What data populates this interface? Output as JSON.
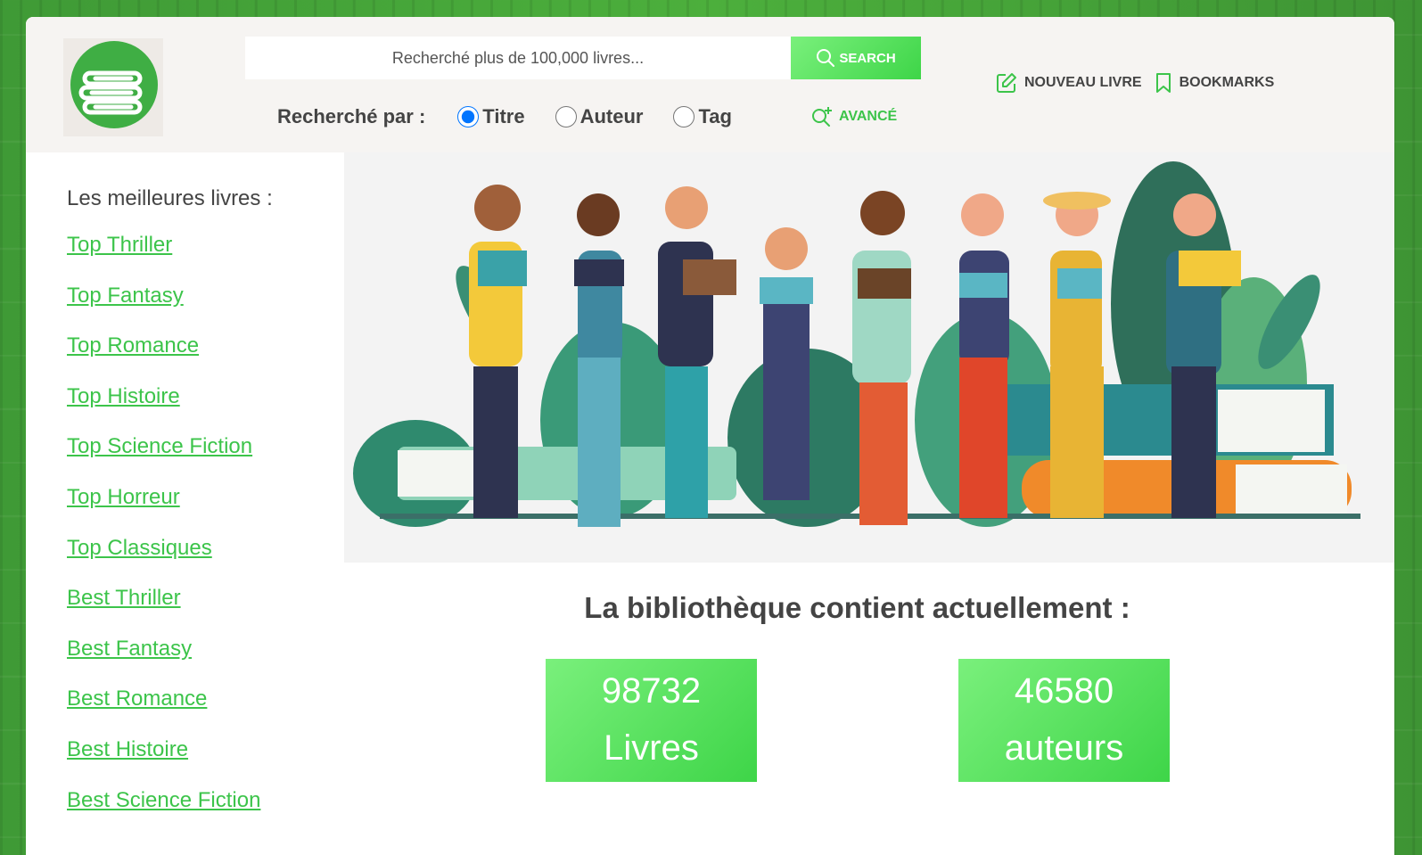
{
  "colors": {
    "accent": "#3cc44a",
    "header_bg": "#f6f4f2",
    "background": "#46a33a"
  },
  "header": {
    "logo_icon": "books-stack-icon",
    "search": {
      "placeholder": "Recherché plus de 100,000 livres...",
      "button_label": "SEARCH"
    },
    "search_by": {
      "label": "Recherché par :",
      "options": [
        "Titre",
        "Auteur",
        "Tag"
      ],
      "selected": "Titre"
    },
    "advanced_label": "AVANCÉ",
    "links": {
      "new_book": "NOUVEAU LIVRE",
      "bookmarks": "BOOKMARKS"
    }
  },
  "sidebar": {
    "title": "Les meilleures livres :",
    "items": [
      "Top Thriller",
      "Top Fantasy",
      "Top Romance",
      "Top Histoire",
      "Top Science Fiction",
      "Top Horreur",
      "Top Classiques",
      "Best Thriller",
      "Best Fantasy",
      "Best Romance",
      "Best Histoire",
      "Best Science Fiction"
    ]
  },
  "hero": {
    "alt": "illustration-people-reading"
  },
  "stats": {
    "title": "La bibliothèque contient actuellement :",
    "books": {
      "value": "98732",
      "label": "Livres"
    },
    "authors": {
      "value": "46580",
      "label": "auteurs"
    }
  }
}
